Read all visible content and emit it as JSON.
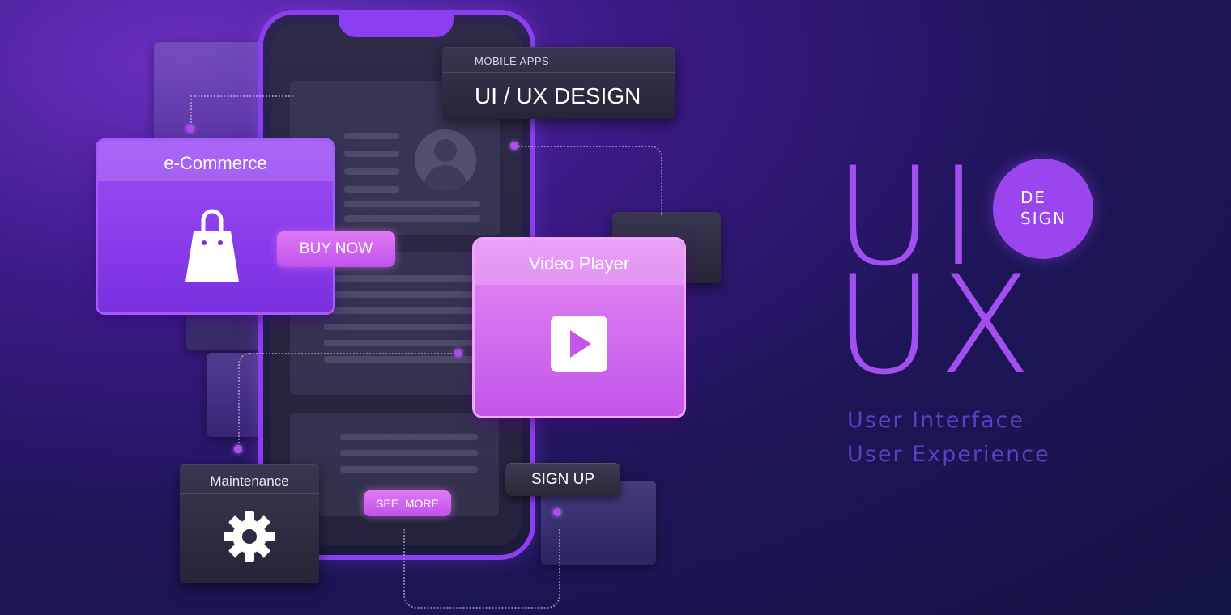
{
  "header_panel": {
    "kicker": "MOBILE APPS",
    "title": "UI / UX DESIGN"
  },
  "ecommerce_card": {
    "title": "e-Commerce",
    "button": "BUY NOW"
  },
  "video_card": {
    "title": "Video Player"
  },
  "maintenance_card": {
    "title": "Maintenance"
  },
  "phone": {
    "see_more": "SEE  MORE",
    "sign_up": "SIGN UP"
  },
  "hero": {
    "ui": "UI",
    "ux": "UX",
    "badge_line1": "DE",
    "badge_line2": "SIGN",
    "tagline1": "User Interface",
    "tagline2": "User Experience"
  },
  "icons": [
    "shopping-bag-icon",
    "play-icon",
    "gear-icon",
    "user-avatar-icon"
  ],
  "colors": {
    "accent": "#a14ff0",
    "pink": "#e58cf5",
    "background": "#1e1558"
  }
}
